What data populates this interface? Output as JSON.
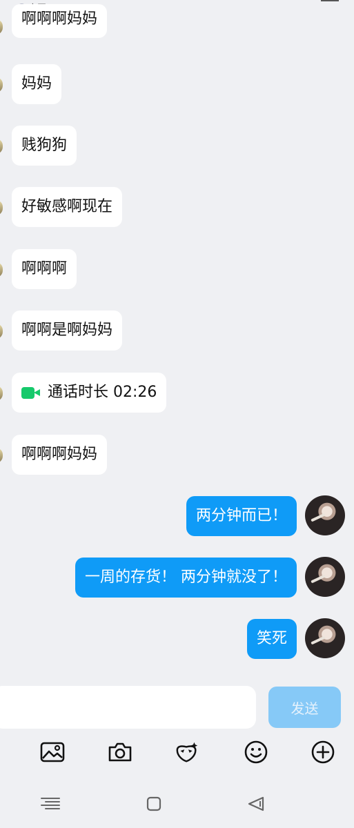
{
  "header": {
    "status_text": "离开",
    "chevron": ">"
  },
  "messages": [
    {
      "side": "in",
      "text": "啊啊啊妈妈"
    },
    {
      "side": "in",
      "text": "妈妈"
    },
    {
      "side": "in",
      "text": "贱狗狗"
    },
    {
      "side": "in",
      "text": "好敏感啊现在"
    },
    {
      "side": "in",
      "text": "啊啊啊"
    },
    {
      "side": "in",
      "text": "啊啊是啊妈妈"
    },
    {
      "side": "in",
      "type": "call",
      "text": "通话时长 02:26"
    },
    {
      "side": "in",
      "text": "啊啊啊妈妈"
    },
    {
      "side": "out",
      "text": "两分钟而已！"
    },
    {
      "side": "out",
      "text": "一周的存货！ 两分钟就没了！"
    },
    {
      "side": "out",
      "text": "笑死"
    }
  ],
  "composer": {
    "input_value": "",
    "send_label": "发送"
  },
  "toolbar_icons": [
    "image-icon",
    "camera-icon",
    "sticker-icon",
    "emoji-icon",
    "plus-icon"
  ],
  "navbar_icons": [
    "menu-icon",
    "home-icon",
    "back-icon"
  ],
  "colors": {
    "background": "#eff0f3",
    "outgoing_bubble": "#0f9bf7",
    "send_button": "#86c9f7",
    "call_icon": "#16c96b"
  }
}
